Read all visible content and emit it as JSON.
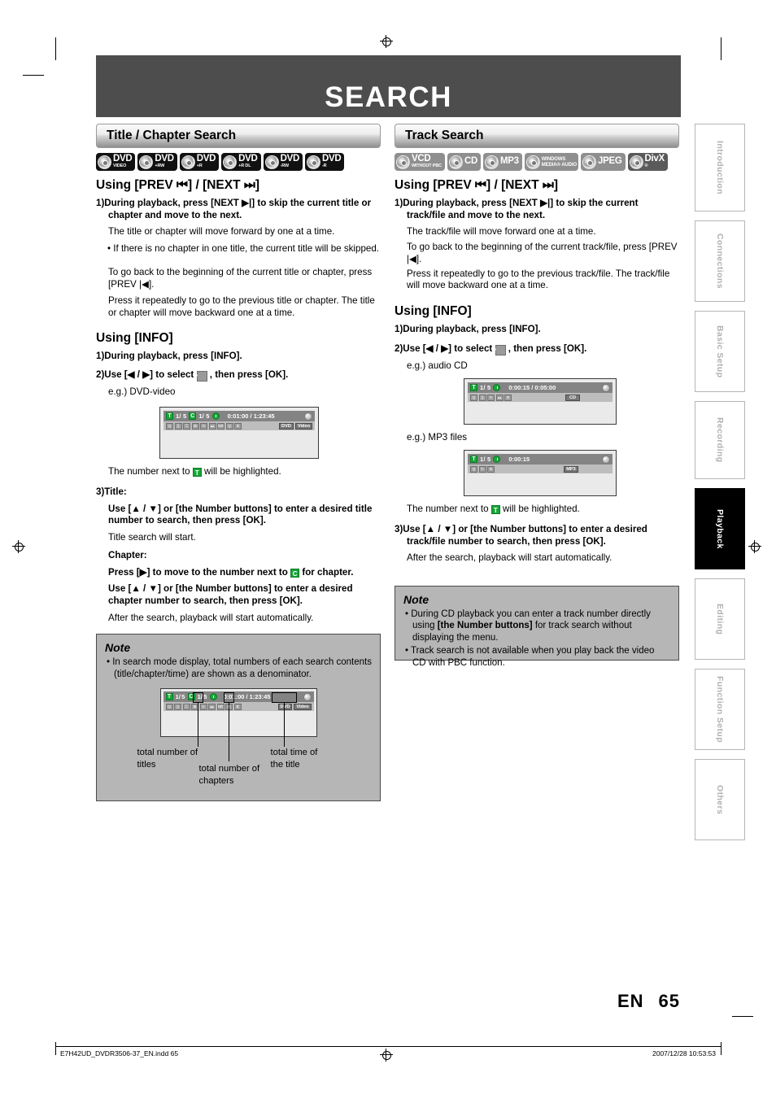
{
  "page": {
    "banner_title": "SEARCH",
    "page_number": "65",
    "language_code": "EN",
    "footer_left": "E7H42UD_DVDR3506-37_EN.indd   65",
    "footer_right": "2007/12/28   10:53:53"
  },
  "side_tabs": [
    {
      "label": "Introduction",
      "active": false
    },
    {
      "label": "Connections",
      "active": false
    },
    {
      "label": "Basic Setup",
      "active": false
    },
    {
      "label": "Recording",
      "active": false
    },
    {
      "label": "Playback",
      "active": true
    },
    {
      "label": "Editing",
      "active": false
    },
    {
      "label": "Function Setup",
      "active": false
    },
    {
      "label": "Others",
      "active": false
    }
  ],
  "left_column": {
    "section_title": "Title / Chapter Search",
    "disc_icons": [
      {
        "name": "DVD",
        "sub": "VIDEO",
        "style": "black"
      },
      {
        "name": "DVD",
        "sub": "+RW",
        "style": "black"
      },
      {
        "name": "DVD",
        "sub": "+R",
        "style": "black"
      },
      {
        "name": "DVD",
        "sub": "+R DL",
        "style": "black"
      },
      {
        "name": "DVD",
        "sub": "-RW",
        "style": "black"
      },
      {
        "name": "DVD",
        "sub": "-R",
        "style": "black"
      }
    ],
    "h_prevnext": "Using [PREV ⏮] / [NEXT ⏭]",
    "s1_bold": "1)During playback, press [NEXT ▶|] to skip the current title or chapter and move to the next.",
    "s1_line1": "The title or chapter will move forward by one at a time.",
    "s1_bullet": "• If there is no chapter in one title, the current title will be skipped.",
    "s1_para2": "To go back to the beginning of the current title or chapter, press [PREV |◀].",
    "s1_para3": "Press it repeatedly to go to the previous title or chapter. The title or chapter will move backward one at a time.",
    "h_info": "Using [INFO]",
    "i1": "1)During playback, press [INFO].",
    "i2_a": "2)Use [◀ / ▶] to select",
    "i2_b": ", then press [OK].",
    "i2_eg": "e.g.) DVD-video",
    "osd_dvd": {
      "title_marker": "T",
      "title_value": "1/  5",
      "chapter_marker": "C",
      "chapter_value": "1/  5",
      "time_value": "0:01:00 / 1:23:45",
      "tags": [
        "DVD",
        "Video"
      ]
    },
    "after_osd": "The number next to  will be highlighted.",
    "after_osd_pre": "The number next to",
    "after_osd_post": "will be highlighted.",
    "s3_title_label": "3)Title:",
    "s3_title_bold": "Use [▲ / ▼] or [the Number buttons] to enter a desired title number to search, then press [OK].",
    "s3_title_plain": "Title search will start.",
    "s3_chapter_label": "Chapter:",
    "s3_chapter_bold1_a": "Press [▶] to move to the number next to",
    "s3_chapter_bold1_b": "for chapter.",
    "s3_chapter_bold2": "Use [▲ / ▼] or [the Number buttons] to enter a desired chapter number to search, then press [OK].",
    "s3_chapter_plain": "After the search, playback will start automatically.",
    "note": {
      "heading": "Note",
      "bullet1": "• In search mode display, total numbers of each search contents (title/chapter/time) are shown as a denominator.",
      "osd": {
        "title_marker": "T",
        "title_num": "1/",
        "title_total": "5",
        "chapter_marker": "C",
        "chapter_num": "1/",
        "chapter_total": "5",
        "time_elapsed": "0:01:00 /",
        "time_total": "1:23:45",
        "tags": [
          "DVD",
          "Video"
        ]
      },
      "callout_titles": "total number of titles",
      "callout_chapters": "total number of chapters",
      "callout_time": "total time of the title"
    }
  },
  "right_column": {
    "section_title": "Track Search",
    "disc_icons": [
      {
        "name": "VCD",
        "sub": "WITHOUT PBC",
        "style": "gray"
      },
      {
        "name": "CD",
        "sub": "",
        "style": "gray"
      },
      {
        "name": "MP3",
        "sub": "",
        "style": "gray"
      },
      {
        "name": "WINDOWS",
        "sub": "MEDIA® AUDIO",
        "style": "gray"
      },
      {
        "name": "JPEG",
        "sub": "",
        "style": "gray"
      },
      {
        "name": "DivX",
        "sub": "®",
        "style": "dark"
      }
    ],
    "h_prevnext": "Using [PREV ⏮] / [NEXT ⏭]",
    "s1_bold": "1)During playback, press [NEXT ▶|] to skip the current track/file and move to the next.",
    "s1_line1": "The track/file will move forward one at a time.",
    "s1_para2": "To go back to the beginning of the current track/file, press [PREV |◀].",
    "s1_para3": "Press it repeatedly to go to the previous track/file. The track/file will move backward one at a time.",
    "h_info": "Using [INFO]",
    "i1": "1)During playback, press [INFO].",
    "i2_a": "2)Use [◀ / ▶] to select",
    "i2_b": ", then press [OK].",
    "i2_eg": "e.g.) audio CD",
    "osd_cd": {
      "title_marker": "T",
      "title_value": "1/  5",
      "time_value": "0:00:15 / 0:05:00",
      "tags": [
        "CD"
      ]
    },
    "eg_mp3": "e.g.) MP3 files",
    "osd_mp3": {
      "title_marker": "T",
      "title_value": "1/  5",
      "time_value": "0:00:15",
      "tags": [
        "MP3"
      ]
    },
    "after_osd_pre": "The number next to",
    "after_osd_post": "will be highlighted.",
    "s3_bold": "3)Use [▲ / ▼] or [the Number buttons] to enter a desired track/file number to search, then press [OK].",
    "s3_plain": "After the search, playback will start automatically.",
    "note": {
      "heading": "Note",
      "bullet1_a": "• During CD playback you can enter a track number directly using",
      "bullet1_bold": "[the Number buttons]",
      "bullet1_b": "for track search without displaying the menu.",
      "bullet2": "• Track search is not available when you play back the video CD with PBC function."
    }
  }
}
